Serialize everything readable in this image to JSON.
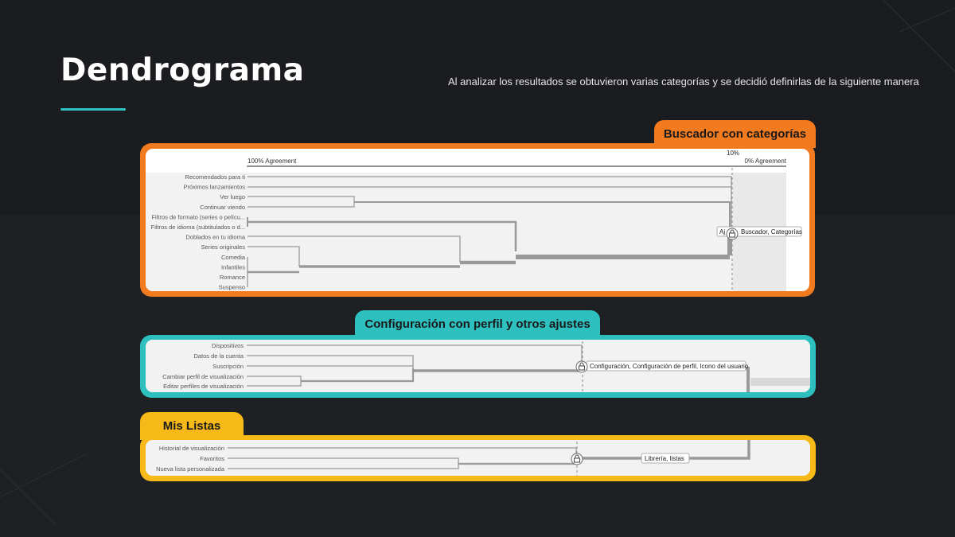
{
  "title": "Dendrograma",
  "subtitle": "Al analizar los resultados se obtuvieron varias categorías y se decidió definirlas de la siguiente manera",
  "colors": {
    "orange": "#f27a1f",
    "teal": "#2ebfbf",
    "yellow": "#f7b917",
    "accent_line": "#2ec4c4"
  },
  "panels": [
    {
      "tab": "Buscador con categorías",
      "axis": {
        "left_label": "100% Agreement",
        "right_label": "0% Agreement",
        "threshold_label": "10%"
      },
      "items": [
        "Recomendados para ti",
        "Próximos lanzamientos",
        "Ver luego",
        "Continuar viendo",
        "Filtros de formato (series o pelícu...",
        "Filtros de idioma (subtitulados o d...",
        "Doblados en tu idioma",
        "Series originales",
        "Comedia",
        "Infantiles",
        "Romance",
        "Suspenso"
      ],
      "cluster_label": "Buscador, Categorías",
      "cluster_label_prefix": "Aj",
      "lock_icon": "lock-icon"
    },
    {
      "tab": "Configuración con perfil y otros ajustes",
      "items": [
        "Dispositivos",
        "Datos de la cuenta",
        "Suscripción",
        "Cambiar perfil de visualización",
        "Editar perfiles de visualización"
      ],
      "cluster_label": "Configuración, Configuración de perfil, Icono del usuario",
      "lock_icon": "lock-icon"
    },
    {
      "tab": "Mis Listas",
      "items": [
        "Historial de visualización",
        "Favoritos",
        "Nueva lista personalizada"
      ],
      "cluster_label": "Librería, listas",
      "lock_icon": "lock-icon"
    }
  ]
}
